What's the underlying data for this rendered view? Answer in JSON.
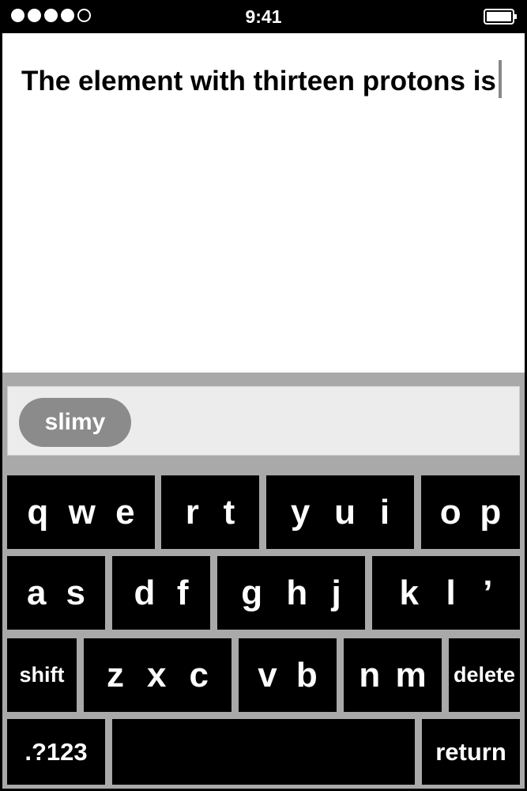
{
  "status_bar": {
    "time": "9:41",
    "signal_bars_full": 4,
    "signal_bars_total": 5,
    "battery_icon": "battery-icon"
  },
  "text_field": {
    "text": "The element with thirteen protons is"
  },
  "suggestion_bar": {
    "suggestions": [
      "slimy"
    ]
  },
  "keyboard": {
    "row1": [
      [
        "q",
        "w",
        "e"
      ],
      [
        "r",
        "t"
      ],
      [
        "y",
        "u",
        "i"
      ],
      [
        "o",
        "p"
      ]
    ],
    "row2": [
      [
        "a",
        "s"
      ],
      [
        "d",
        "f"
      ],
      [
        "g",
        "h",
        "j"
      ],
      [
        "k",
        "l",
        "’"
      ]
    ],
    "row3_keys": {
      "shift": "shift",
      "groups": [
        [
          "z",
          "x",
          "c"
        ],
        [
          "v",
          "b"
        ],
        [
          "n",
          "m"
        ]
      ],
      "delete": "delete"
    },
    "row4": {
      "numbers": ".?123",
      "space": "",
      "return": "return"
    }
  },
  "colors": {
    "background": "#000000",
    "text_area": "#ffffff",
    "keyboard_frame": "#a9a9a9",
    "suggestion_bar": "#ececec",
    "suggestion_pill": "#8b8b8b",
    "cursor": "#888888"
  }
}
